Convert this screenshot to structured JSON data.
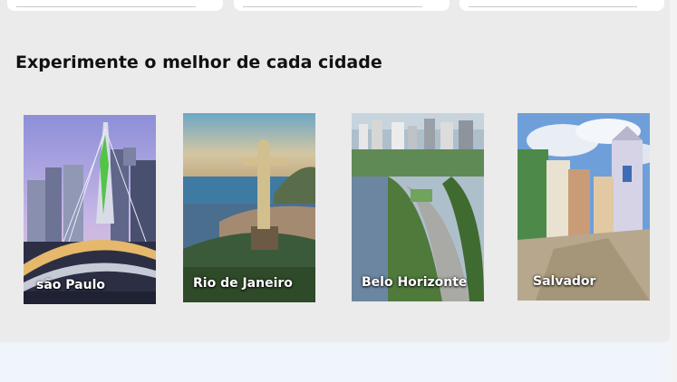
{
  "section": {
    "title": "Experimente o melhor de cada cidade"
  },
  "cities": [
    {
      "name": "são Paulo"
    },
    {
      "name": "Rio de Janeiro"
    },
    {
      "name": "Belo Horizonte"
    },
    {
      "name": "Salvador"
    }
  ]
}
